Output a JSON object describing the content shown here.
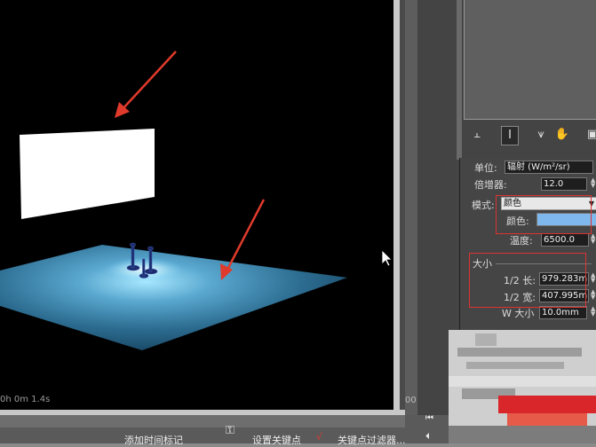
{
  "viewport": {
    "render_time": "0h 0m 1.4s"
  },
  "side_ruler": {
    "value": "00"
  },
  "toolbar": {
    "icons": [
      "pin-icon",
      "stack-icon",
      "modifier-icon",
      "hierarchy-icon",
      "display-icon"
    ]
  },
  "parameters": {
    "unit_label": "单位:",
    "unit_value": "辐射 (W/m²/sr)",
    "multiplier_label": "倍增器:",
    "multiplier_value": "12.0",
    "mode_label": "模式:",
    "mode_value": "颜色",
    "color_label": "颜色:",
    "color_swatch": "#7fb8ec",
    "temperature_label": "温度:",
    "temperature_value": "6500.0",
    "size_group_title": "大小",
    "half_length_label": "1/2 长:",
    "half_length_value": "979.283m",
    "half_width_label": "1/2 宽:",
    "half_width_value": "407.995m",
    "w_size_label": "W 大小",
    "w_size_value": "10.0mm"
  },
  "status_bar": {
    "add_time_tag": "添加时间标记",
    "set_key": "设置关键点",
    "key_filters": "关键点过滤器..."
  },
  "colors": {
    "annotation_red": "#e03a2c",
    "highlight_box": "#d33333"
  }
}
